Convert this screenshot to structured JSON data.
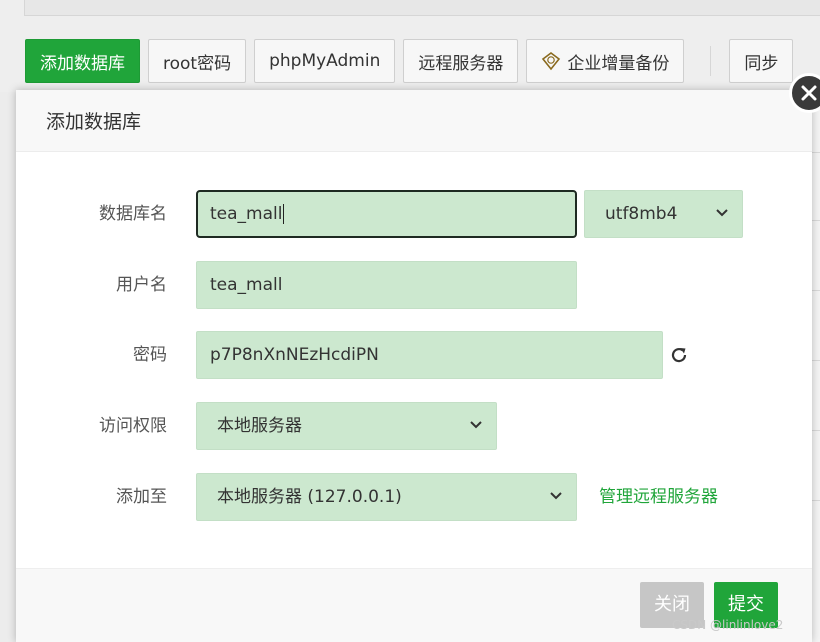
{
  "toolbar": {
    "add_db": "添加数据库",
    "root_pwd": "root密码",
    "phpmyadmin": "phpMyAdmin",
    "remote_server": "远程服务器",
    "enterprise_backup": "企业增量备份",
    "sync_partial": "同步"
  },
  "dialog": {
    "title": "添加数据库",
    "fields": {
      "db_name": {
        "label": "数据库名",
        "value": "tea_mall"
      },
      "charset": {
        "value": "utf8mb4"
      },
      "username": {
        "label": "用户名",
        "value": "tea_mall"
      },
      "password": {
        "label": "密码",
        "value": "p7P8nXnNEzHcdiPN"
      },
      "access": {
        "label": "访问权限",
        "value": "本地服务器"
      },
      "add_to": {
        "label": "添加至",
        "value": "本地服务器 (127.0.0.1)",
        "link": "管理远程服务器"
      }
    },
    "buttons": {
      "close": "关闭",
      "submit": "提交"
    }
  },
  "watermark": "CSDN @linlinlove2",
  "colors": {
    "accent": "#20a53a",
    "field_bg": "#cce8cf",
    "close_btn": "#c6c6c6"
  }
}
